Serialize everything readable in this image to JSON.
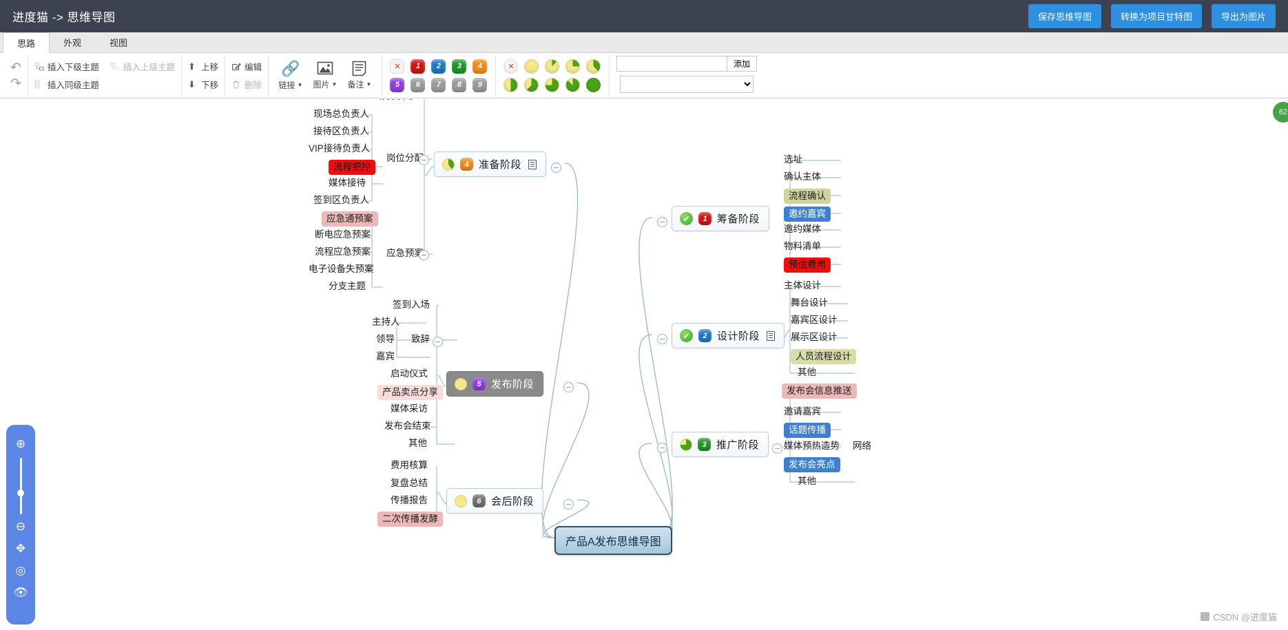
{
  "titlebar": {
    "title": "进度猫 -> 思维导图",
    "buttons": [
      {
        "label": "保存思维导图",
        "name": "save-mindmap-button"
      },
      {
        "label": "转换为项目甘特图",
        "name": "convert-to-gantt-button"
      },
      {
        "label": "导出为图片",
        "name": "export-image-button"
      }
    ],
    "accent": "#2f8fe0",
    "background": "#3c4250"
  },
  "menu": {
    "tabs": [
      {
        "label": "思路",
        "active": true
      },
      {
        "label": "外观",
        "active": false
      },
      {
        "label": "视图",
        "active": false
      }
    ]
  },
  "ribbon": {
    "undo_label": "撤销",
    "redo_label": "重做",
    "topic_actions": [
      {
        "label": "插入下级主题",
        "disabled": false
      },
      {
        "label": "插入上级主题",
        "disabled": true
      },
      {
        "label": "插入同级主题",
        "disabled": false
      }
    ],
    "move_actions": [
      {
        "label": "上移",
        "disabled": false
      },
      {
        "label": "下移",
        "disabled": false
      }
    ],
    "edit_actions": [
      {
        "label": "编辑",
        "disabled": false
      },
      {
        "label": "删除",
        "disabled": true
      }
    ],
    "big_buttons": [
      {
        "label": "链接",
        "icon": "link-icon",
        "caret": true
      },
      {
        "label": "图片",
        "icon": "image-icon",
        "caret": true
      },
      {
        "label": "备注",
        "icon": "note-icon",
        "caret": true
      }
    ],
    "priority": {
      "none_label": "✕",
      "items": [
        {
          "label": "1",
          "color": "#d41111"
        },
        {
          "label": "2",
          "color": "#1878c8"
        },
        {
          "label": "3",
          "color": "#1b9626"
        },
        {
          "label": "4",
          "color": "#ef8b16"
        },
        {
          "label": "5",
          "color": "#8b3ee0"
        },
        {
          "label": "6",
          "color": "#9a9a9a"
        },
        {
          "label": "7",
          "color": "#9a9a9a"
        },
        {
          "label": "8",
          "color": "#9a9a9a"
        },
        {
          "label": "9",
          "color": "#9a9a9a"
        }
      ]
    },
    "progress": {
      "none_label": "✕",
      "items": [
        {
          "percent": 0,
          "base": "#f4e98a",
          "fill": "#49a518"
        },
        {
          "percent": 12,
          "base": "#f4e98a",
          "fill": "#49a518"
        },
        {
          "percent": 25,
          "base": "#f4e98a",
          "fill": "#49a518"
        },
        {
          "percent": 37,
          "base": "#f4e98a",
          "fill": "#49a518"
        },
        {
          "percent": 50,
          "base": "#f4e98a",
          "fill": "#49a518"
        },
        {
          "percent": 62,
          "base": "#f4e98a",
          "fill": "#49a518"
        },
        {
          "percent": 75,
          "base": "#f4e98a",
          "fill": "#49a518"
        },
        {
          "percent": 87,
          "base": "#f4e98a",
          "fill": "#49a518"
        },
        {
          "percent": 100,
          "base": "#49a518",
          "fill": "#49a518"
        }
      ]
    },
    "add": {
      "input_value": "",
      "input_placeholder": "",
      "button_label": "添加",
      "select_value": ""
    }
  },
  "zoombar": {
    "zoom_in": "zoom-in-icon",
    "zoom_out": "zoom-out-icon",
    "slider_value": 50,
    "move": "move-icon",
    "center": "center-icon",
    "eye": "eye-icon"
  },
  "side_tab": {
    "label": "62"
  },
  "watermark": {
    "text": "CSDN @进度猫"
  },
  "mindmap": {
    "root": {
      "text": "产品A发布思维导图"
    },
    "branches": [
      {
        "text": "准备阶段",
        "badge": "4",
        "badge_color": "#ef8b16",
        "progress": 40,
        "has_note": true,
        "side": "left",
        "children": [
          {
            "text": "彩排演练"
          },
          {
            "text": "岗位分配",
            "children": [
              {
                "text": "现场总负责人"
              },
              {
                "text": "接待区负责人"
              },
              {
                "text": "VIP接待负责人"
              },
              {
                "text": "流程把控",
                "chip": "red"
              },
              {
                "text": "媒体接待"
              },
              {
                "text": "签到区负责人"
              }
            ]
          },
          {
            "text": "应急预案",
            "children": [
              {
                "text": "应急通预案",
                "chip": "pink"
              },
              {
                "text": "断电应急预案"
              },
              {
                "text": "流程应急预案"
              },
              {
                "text": "电子设备失预案"
              },
              {
                "text": "分支主题"
              }
            ]
          }
        ]
      },
      {
        "text": "筹备阶段",
        "badge": "1",
        "badge_color": "#d41111",
        "check": true,
        "side": "right",
        "children": [
          {
            "text": "选址"
          },
          {
            "text": "确认主体"
          },
          {
            "text": "流程确认",
            "chip": "olive"
          },
          {
            "text": "邀约嘉宾",
            "chip": "blue"
          },
          {
            "text": "邀约媒体"
          },
          {
            "text": "物料清单"
          },
          {
            "text": "预估费用",
            "chip": "red"
          }
        ]
      },
      {
        "text": "设计阶段",
        "badge": "2",
        "badge_color": "#1878c8",
        "check": true,
        "has_note": true,
        "side": "right",
        "children": [
          {
            "text": "主体设计"
          },
          {
            "text": "舞台设计"
          },
          {
            "text": "嘉宾区设计"
          },
          {
            "text": "展示区设计"
          },
          {
            "text": "人员流程设计",
            "chip": "olive2"
          },
          {
            "text": "其他"
          }
        ]
      },
      {
        "text": "推广阶段",
        "badge": "3",
        "badge_color": "#1b9626",
        "progress": 75,
        "side": "right",
        "children": [
          {
            "text": "发布会信息推送",
            "chip": "pink"
          },
          {
            "text": "邀请嘉宾"
          },
          {
            "text": "话题传播",
            "chip": "blue"
          },
          {
            "text": "媒体预热造势",
            "children": [
              {
                "text": "网络"
              }
            ]
          },
          {
            "text": "发布会亮点",
            "chip": "blue"
          },
          {
            "text": "其他"
          }
        ]
      },
      {
        "text": "发布阶段",
        "badge": "5",
        "badge_color": "#8b3ee0",
        "progress": 0,
        "selected": true,
        "side": "left",
        "children": [
          {
            "text": "签到入场"
          },
          {
            "text": "致辞",
            "children": [
              {
                "text": "主持人"
              },
              {
                "text": "领导"
              },
              {
                "text": "嘉宾"
              }
            ]
          },
          {
            "text": "启动仪式"
          },
          {
            "text": "产品卖点分享",
            "chip": "pink2"
          },
          {
            "text": "媒体采访"
          },
          {
            "text": "发布会结束"
          },
          {
            "text": "其他"
          }
        ]
      },
      {
        "text": "会后阶段",
        "badge": "6",
        "badge_color": "#6f6f6f",
        "progress": 0,
        "side": "left",
        "children": [
          {
            "text": "费用核算"
          },
          {
            "text": "复盘总结"
          },
          {
            "text": "传播报告"
          },
          {
            "text": "二次传播发酵",
            "chip": "pink"
          }
        ]
      }
    ]
  }
}
